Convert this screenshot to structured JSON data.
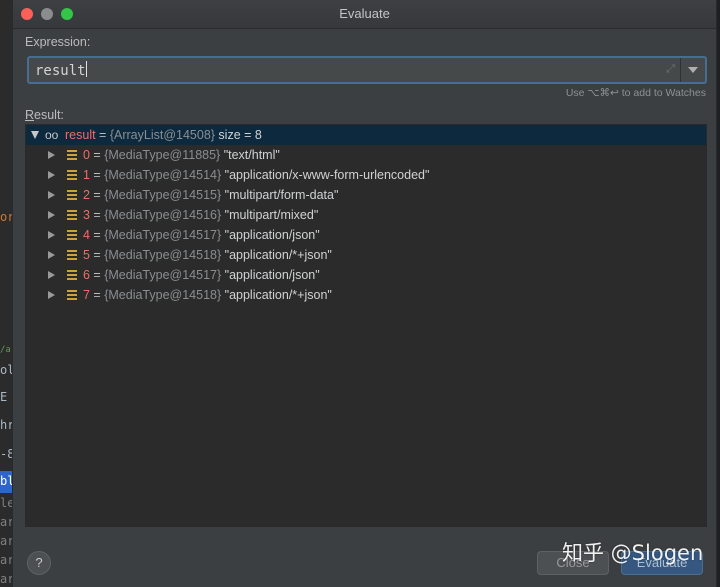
{
  "window": {
    "title": "Evaluate"
  },
  "expression": {
    "label": "Expression:",
    "value": "result",
    "hint": "Use ⌥⌘↩ to add to Watches"
  },
  "result": {
    "label_first": "R",
    "label_rest": "esult:",
    "root": {
      "name": "result",
      "eq": " = ",
      "ref": "{ArrayList@14508}",
      "extra": " size = 8"
    },
    "items": [
      {
        "name": "0",
        "eq": " = ",
        "ref": "{MediaType@11885}",
        "value": " \"text/html\""
      },
      {
        "name": "1",
        "eq": " = ",
        "ref": "{MediaType@14514}",
        "value": " \"application/x-www-form-urlencoded\""
      },
      {
        "name": "2",
        "eq": " = ",
        "ref": "{MediaType@14515}",
        "value": " \"multipart/form-data\""
      },
      {
        "name": "3",
        "eq": " = ",
        "ref": "{MediaType@14516}",
        "value": " \"multipart/mixed\""
      },
      {
        "name": "4",
        "eq": " = ",
        "ref": "{MediaType@14517}",
        "value": " \"application/json\""
      },
      {
        "name": "5",
        "eq": " = ",
        "ref": "{MediaType@14518}",
        "value": " \"application/*+json\""
      },
      {
        "name": "6",
        "eq": " = ",
        "ref": "{MediaType@14517}",
        "value": " \"application/json\""
      },
      {
        "name": "7",
        "eq": " = ",
        "ref": "{MediaType@14518}",
        "value": " \"application/*+json\""
      }
    ]
  },
  "buttons": {
    "help": "?",
    "close": "Close",
    "evaluate": "Evaluate"
  },
  "watermark": "知乎 @Slogen",
  "background_fragments": [
    "or",
    "/a",
    "olic",
    "E",
    "hr",
    "-8",
    "bl",
    "le",
    "arr",
    "arr",
    "arr",
    "arr"
  ],
  "colors": {
    "selection": "#0d293e",
    "field_name": "#ee6e65",
    "field_icon": "#d1a334",
    "focus_border": "#466d94"
  },
  "icons": {
    "watch": "glasses-icon",
    "field": "field-icon",
    "expand": "expand-icon",
    "dropdown": "chevron-down-icon",
    "help": "help-icon"
  }
}
